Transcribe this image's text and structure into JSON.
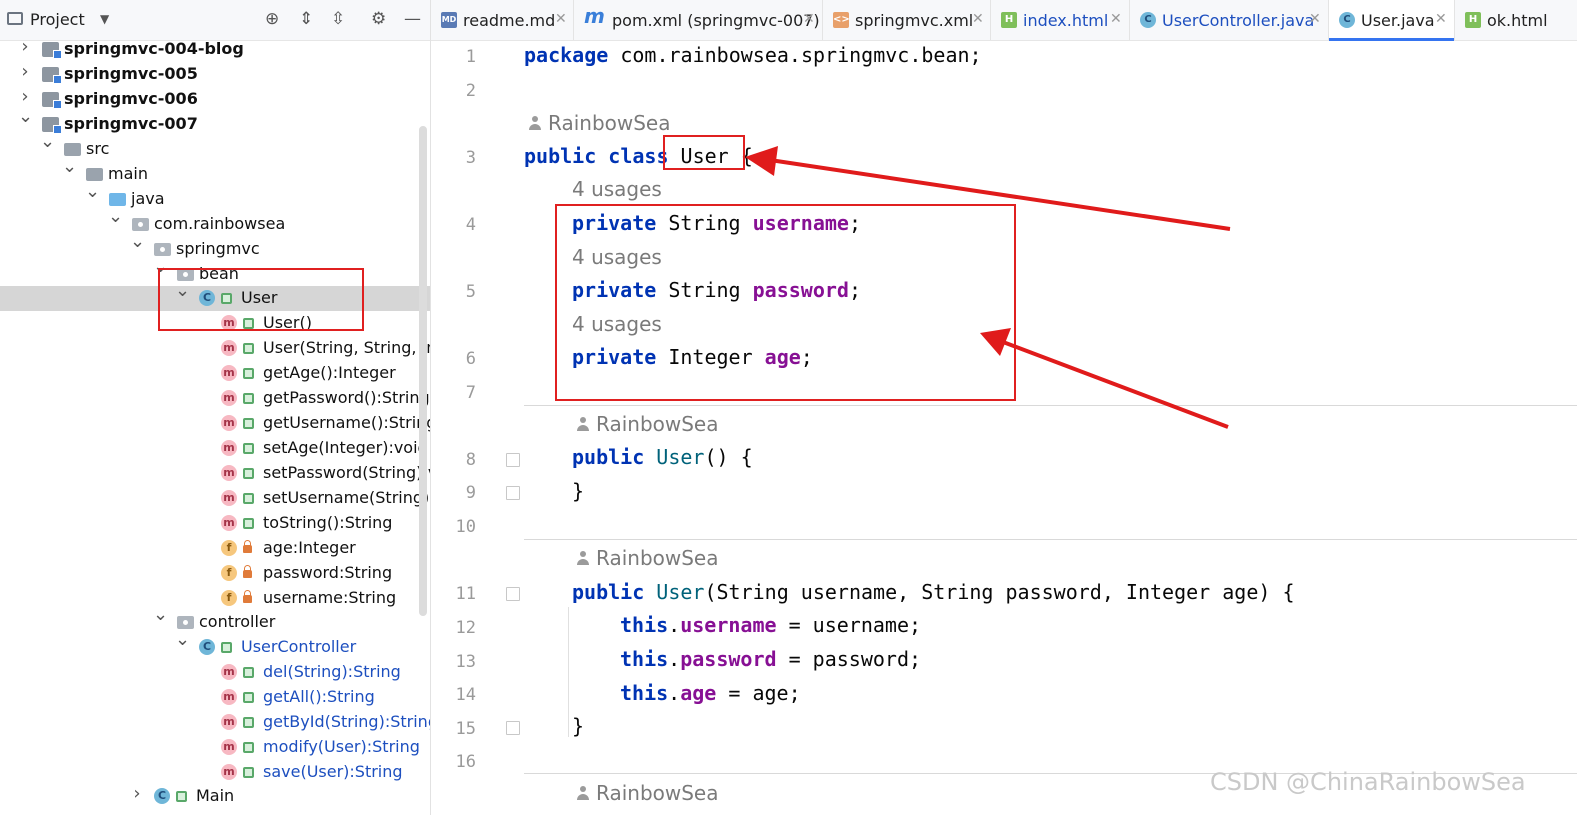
{
  "project": {
    "title": "Project",
    "tree": [
      {
        "label": "springmvc-004-blog",
        "style": "bold",
        "icon": "module"
      },
      {
        "label": "springmvc-005",
        "style": "bold",
        "icon": "module"
      },
      {
        "label": "springmvc-006",
        "style": "bold",
        "icon": "module"
      },
      {
        "label": "springmvc-007",
        "style": "bold",
        "icon": "module"
      },
      {
        "label": "src",
        "icon": "folder"
      },
      {
        "label": "main",
        "icon": "folder"
      },
      {
        "label": "java",
        "icon": "source-folder"
      },
      {
        "label": "com.rainbowsea",
        "icon": "package"
      },
      {
        "label": "springmvc",
        "icon": "package"
      },
      {
        "label": "bean",
        "icon": "package"
      },
      {
        "label": "User",
        "icon": "class"
      },
      {
        "label": "User()",
        "icon": "method"
      },
      {
        "label": "User(String, String, Inte",
        "icon": "method"
      },
      {
        "label": "getAge():Integer",
        "icon": "method"
      },
      {
        "label": "getPassword():String",
        "icon": "method"
      },
      {
        "label": "getUsername():String",
        "icon": "method"
      },
      {
        "label": "setAge(Integer):void",
        "icon": "method"
      },
      {
        "label": "setPassword(String):vo",
        "icon": "method"
      },
      {
        "label": "setUsername(String):vo",
        "icon": "method"
      },
      {
        "label": "toString():String",
        "icon": "method"
      },
      {
        "label": "age:Integer",
        "icon": "field"
      },
      {
        "label": "password:String",
        "icon": "field"
      },
      {
        "label": "username:String",
        "icon": "field"
      },
      {
        "label": "controller",
        "icon": "package"
      },
      {
        "label": "UserController",
        "style": "blue",
        "icon": "class"
      },
      {
        "label": "del(String):String",
        "style": "blue",
        "icon": "method"
      },
      {
        "label": "getAll():String",
        "style": "blue",
        "icon": "method"
      },
      {
        "label": "getById(String):String",
        "style": "blue",
        "icon": "method"
      },
      {
        "label": "modify(User):String",
        "style": "blue",
        "icon": "method"
      },
      {
        "label": "save(User):String",
        "style": "blue",
        "icon": "method"
      },
      {
        "label": "Main",
        "icon": "class"
      }
    ]
  },
  "tabs": [
    {
      "name": "readme.md",
      "icon": "MD"
    },
    {
      "name": "pom.xml (springmvc-007)",
      "icon": "m"
    },
    {
      "name": "springmvc.xml",
      "icon": "xml"
    },
    {
      "name": "index.html",
      "icon": "H"
    },
    {
      "name": "UserController.java",
      "icon": "C"
    },
    {
      "name": "User.java",
      "icon": "C"
    },
    {
      "name": "ok.html",
      "icon": "H"
    }
  ],
  "editor": {
    "line_numbers": [
      "1",
      "2",
      "3",
      "4",
      "5",
      "6",
      "7",
      "8",
      "9",
      "10",
      "11",
      "12",
      "13",
      "14",
      "15",
      "16"
    ],
    "author": "RainbowSea",
    "usages": "4 usages",
    "code": {
      "l1_kw": "package",
      "l1_rest": " com.rainbowsea.springmvc.bean;",
      "l3_kw": "public class",
      "l3_name": " User",
      "l3_brace": " {",
      "private": "private",
      "string": " String ",
      "integer": " Integer ",
      "f_username": "username",
      "f_password": "password",
      "f_age": "age",
      "semi": ";",
      "public": "public",
      "ctor": " User",
      "ctor_args_empty": "() {",
      "close": "}",
      "ctor_open": "(",
      "ctor_params": "String username, String password, Integer age",
      "ctor_close": ") {",
      "this": "this",
      "dot": ".",
      "assign_username": " = username;",
      "assign_password": " = password;",
      "assign_age": " = age;"
    }
  },
  "watermark": "CSDN @ChinaRainbowSea"
}
